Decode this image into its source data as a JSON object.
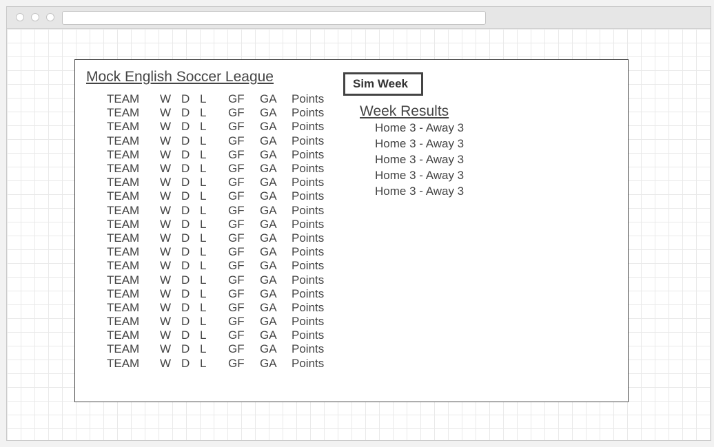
{
  "browser": {
    "address": ""
  },
  "page": {
    "title": "Mock English Soccer League"
  },
  "standings": {
    "rows": [
      {
        "team": "TEAM",
        "w": "W",
        "d": "D",
        "l": "L",
        "gf": "GF",
        "ga": "GA",
        "points": "Points"
      },
      {
        "team": "TEAM",
        "w": "W",
        "d": "D",
        "l": "L",
        "gf": "GF",
        "ga": "GA",
        "points": "Points"
      },
      {
        "team": "TEAM",
        "w": "W",
        "d": "D",
        "l": "L",
        "gf": "GF",
        "ga": "GA",
        "points": "Points"
      },
      {
        "team": "TEAM",
        "w": "W",
        "d": "D",
        "l": "L",
        "gf": "GF",
        "ga": "GA",
        "points": "Points"
      },
      {
        "team": "TEAM",
        "w": "W",
        "d": "D",
        "l": "L",
        "gf": "GF",
        "ga": "GA",
        "points": "Points"
      },
      {
        "team": "TEAM",
        "w": "W",
        "d": "D",
        "l": "L",
        "gf": "GF",
        "ga": "GA",
        "points": "Points"
      },
      {
        "team": "TEAM",
        "w": "W",
        "d": "D",
        "l": "L",
        "gf": "GF",
        "ga": "GA",
        "points": "Points"
      },
      {
        "team": "TEAM",
        "w": "W",
        "d": "D",
        "l": "L",
        "gf": "GF",
        "ga": "GA",
        "points": "Points"
      },
      {
        "team": "TEAM",
        "w": "W",
        "d": "D",
        "l": "L",
        "gf": "GF",
        "ga": "GA",
        "points": "Points"
      },
      {
        "team": "TEAM",
        "w": "W",
        "d": "D",
        "l": "L",
        "gf": "GF",
        "ga": "GA",
        "points": "Points"
      },
      {
        "team": "TEAM",
        "w": "W",
        "d": "D",
        "l": "L",
        "gf": "GF",
        "ga": "GA",
        "points": "Points"
      },
      {
        "team": "TEAM",
        "w": "W",
        "d": "D",
        "l": "L",
        "gf": "GF",
        "ga": "GA",
        "points": "Points"
      },
      {
        "team": "TEAM",
        "w": "W",
        "d": "D",
        "l": "L",
        "gf": "GF",
        "ga": "GA",
        "points": "Points"
      },
      {
        "team": "TEAM",
        "w": "W",
        "d": "D",
        "l": "L",
        "gf": "GF",
        "ga": "GA",
        "points": "Points"
      },
      {
        "team": "TEAM",
        "w": "W",
        "d": "D",
        "l": "L",
        "gf": "GF",
        "ga": "GA",
        "points": "Points"
      },
      {
        "team": "TEAM",
        "w": "W",
        "d": "D",
        "l": "L",
        "gf": "GF",
        "ga": "GA",
        "points": "Points"
      },
      {
        "team": "TEAM",
        "w": "W",
        "d": "D",
        "l": "L",
        "gf": "GF",
        "ga": "GA",
        "points": "Points"
      },
      {
        "team": "TEAM",
        "w": "W",
        "d": "D",
        "l": "L",
        "gf": "GF",
        "ga": "GA",
        "points": "Points"
      },
      {
        "team": "TEAM",
        "w": "W",
        "d": "D",
        "l": "L",
        "gf": "GF",
        "ga": "GA",
        "points": "Points"
      },
      {
        "team": "TEAM",
        "w": "W",
        "d": "D",
        "l": "L",
        "gf": "GF",
        "ga": "GA",
        "points": "Points"
      }
    ]
  },
  "controls": {
    "sim_week_label": "Sim Week"
  },
  "week_results": {
    "title": "Week Results",
    "matches": [
      "Home 3 - Away 3",
      "Home 3 - Away 3",
      "Home 3 - Away 3",
      "Home 3 - Away 3",
      "Home 3 - Away 3"
    ]
  }
}
